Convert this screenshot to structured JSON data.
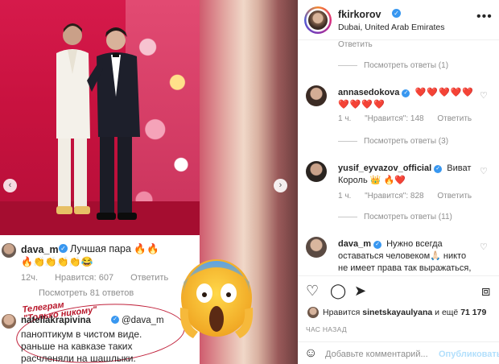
{
  "left": {
    "comment1": {
      "username": "dava_m",
      "text": "Лучшая пара 🔥🔥",
      "emojis": "🔥👏👏👏👏😂",
      "time": "12ч.",
      "likes": "Нравится: 607",
      "reply": "Ответить",
      "view_replies": "Посмотреть 81 ответов"
    },
    "comment2": {
      "stamp_line1": "Телеграм",
      "stamp_line2": "\"Только никому\"",
      "username": "natellakrapivina",
      "mention": "@dava_m",
      "line1": "паноптикум в чистом виде.",
      "line2": "раньше на кавказе таких",
      "line3": "расчленяли на шашлыки."
    }
  },
  "post": {
    "username": "fkirkorov",
    "location": "Dubai, United Arab Emirates",
    "more_icon": "more-icon"
  },
  "comments": [
    {
      "reply_label": "Ответить",
      "view_replies": "Посмотреть ответы (1)"
    },
    {
      "username": "annasedokova",
      "text": "❤️❤️❤️❤️❤️❤️❤️❤️❤️",
      "time": "1 ч.",
      "likes": "\"Нравится\": 148",
      "reply": "Ответить",
      "view_replies": "Посмотреть ответы (3)"
    },
    {
      "username": "yusif_eyvazov_official",
      "text": "Виват Король 👑 🔥❤️",
      "time": "1 ч.",
      "likes": "\"Нравится\": 828",
      "reply": "Ответить",
      "view_replies": "Посмотреть ответы (11)"
    },
    {
      "username": "dava_m",
      "text": "Нужно всегда оставаться человеком🙏🏻 никто не имеет права так выражаться, оскорблять и унижать других"
    }
  ],
  "likes": {
    "liked_by_prefix": "Нравится",
    "liked_by_user": "sinetskayaulyana",
    "and_more": "и ещё",
    "count": "71 179"
  },
  "time_ago": "ЧАС НАЗАД",
  "add_comment": {
    "placeholder": "Добавьте комментарий...",
    "publish": "Опубликовать"
  }
}
